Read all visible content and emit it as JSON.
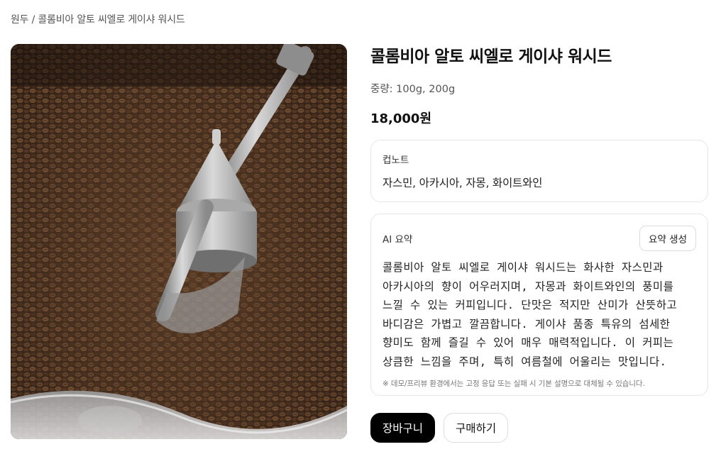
{
  "breadcrumb": "원두 / 콜롬비아 알토 씨엘로 게이샤 워시드",
  "product": {
    "title": "콜롬비아 알토 씨엘로 게이샤 워시드",
    "weight": "중량: 100g, 200g",
    "price": "18,000원",
    "image_icon": "coffee-roaster-photo"
  },
  "cup_note": {
    "label": "컵노트",
    "text": "자스민, 아카시아, 자몽, 화이트와인"
  },
  "ai_summary": {
    "label": "AI 요약",
    "button": "요약 생성",
    "text": "콜롬비아 알토 씨엘로 게이샤 워시드는 화사한 자스민과 아카시아의 향이 어우러지며, 자몽과 화이트와인의 풍미를 느낄 수 있는 커피입니다. 단맛은 적지만 산미가 산뜻하고 바디감은 가볍고 깔끔합니다. 게이샤 품종 특유의 섬세한 향미도 함께 즐길 수 있어 매우 매력적입니다. 이 커피는 상큼한 느낌을 주며, 특히 여름철에 어울리는 맛입니다.",
    "note": "※ 데모/프리뷰 환경에서는 고정 응답 또는 실패 시 기본 설명으로 대체될 수 있습니다."
  },
  "actions": {
    "cart": "장바구니",
    "buy": "구매하기"
  },
  "colors": {
    "primary_button": "#000000",
    "border": "#e6e6e6"
  }
}
